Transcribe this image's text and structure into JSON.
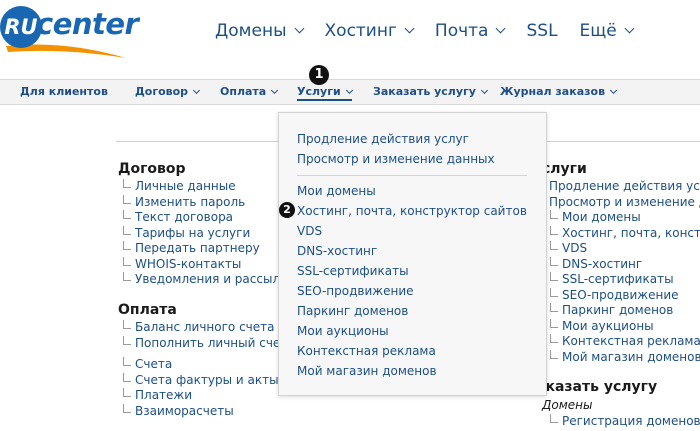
{
  "logo": {
    "mark_text": "RU",
    "name": "center",
    "accent_color": "#1967b2",
    "swoosh_color": "#f39200"
  },
  "top_nav": [
    {
      "label": "Домены",
      "has_chevron": true
    },
    {
      "label": "Хостинг",
      "has_chevron": true
    },
    {
      "label": "Почта",
      "has_chevron": true
    },
    {
      "label": "SSL",
      "has_chevron": false
    },
    {
      "label": "Ещё",
      "has_chevron": true
    }
  ],
  "sub_nav": [
    {
      "label": "Для клиентов",
      "has_chevron": false
    },
    {
      "label": "Договор",
      "has_chevron": true
    },
    {
      "label": "Оплата",
      "has_chevron": true
    },
    {
      "label": "Услуги",
      "has_chevron": true,
      "active": true
    },
    {
      "label": "Заказать услугу",
      "has_chevron": true
    },
    {
      "label": "Журнал заказов",
      "has_chevron": true
    }
  ],
  "badges": {
    "one": "1",
    "two": "2"
  },
  "dropdown": {
    "group1": [
      "Продление действия услуг",
      "Просмотр и изменение данных"
    ],
    "group2": [
      "Мои домены",
      "Хостинг, почта, конструктор сайтов",
      "VDS",
      "DNS-хостинг",
      "SSL-сертификаты",
      "SEO-продвижение",
      "Паркинг доменов",
      "Мои аукционы",
      "Контекстная реклама",
      "Мой магазин доменов"
    ]
  },
  "left": {
    "contract": {
      "title": "Договор",
      "items": [
        "Личные данные",
        "Изменить пароль",
        "Текст договора",
        "Тарифы на услуги",
        "Передать партнеру",
        "WHOIS-контакты",
        "Уведомления и рассылки"
      ]
    },
    "payment": {
      "title": "Оплата",
      "items1": [
        "Баланс личного счета",
        "Пополнить личный счет"
      ],
      "items2": [
        "Счета",
        "Счета фактуры и акты",
        "Платежи",
        "Взаиморасчеты"
      ]
    }
  },
  "right": {
    "services": {
      "title": "слуги",
      "items_top": [
        "Продление действия услуг",
        "Просмотр и изменение данных"
      ],
      "items_deep": [
        "Мои домены",
        "Хостинг, почта, конструк",
        "VDS",
        "DNS-хостинг",
        "SSL-сертификаты",
        "SEO-продвижение",
        "Паркинг доменов",
        "Мои аукционы",
        "Контекстная реклама",
        "Мой магазин доменов"
      ]
    },
    "order": {
      "title": "аказать услугу",
      "sub_label": "Домены",
      "items": [
        "Регистрация доменов"
      ]
    }
  }
}
